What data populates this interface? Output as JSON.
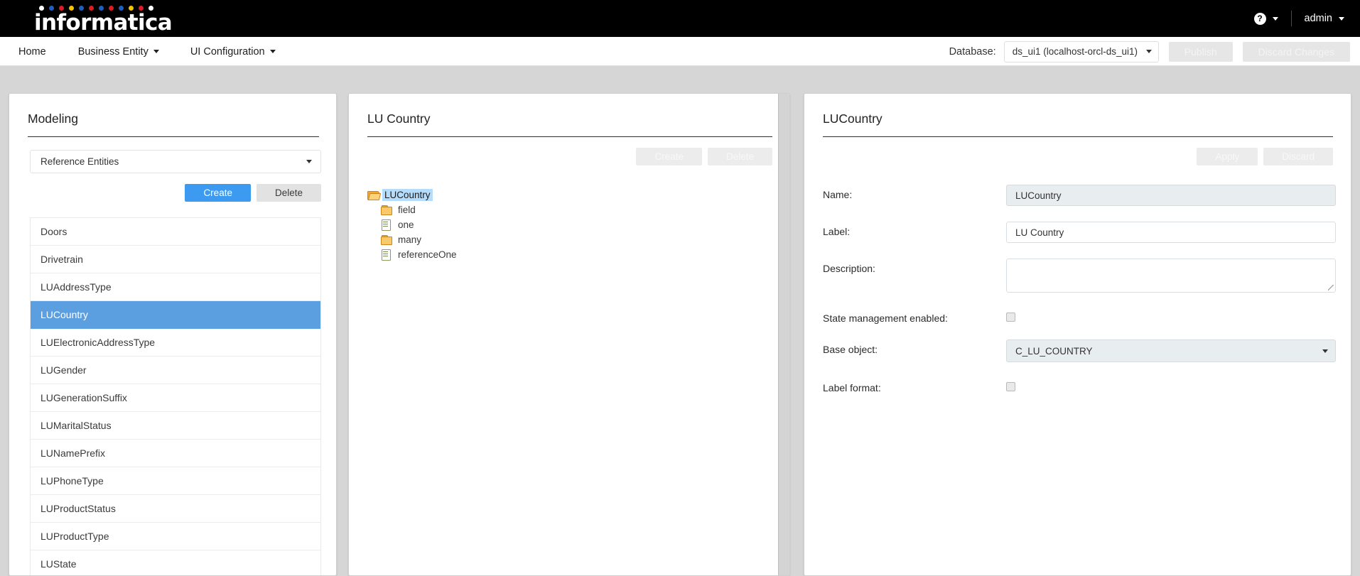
{
  "topbar": {
    "logo_text": "informatica",
    "logo_dot_colors": [
      "#ffffff",
      "#1f5fc4",
      "#e01b24",
      "#f5c400",
      "#1f5fc4",
      "#e01b24",
      "#1f5fc4",
      "#e01b24",
      "#1f5fc4",
      "#f5c400",
      "#e01b24",
      "#ffffff"
    ],
    "help_icon": "help-circle-icon",
    "help_caret_icon": "chevron-down-icon",
    "user_label": "admin",
    "user_caret_icon": "chevron-down-icon"
  },
  "nav": {
    "items": [
      {
        "label": "Home",
        "has_caret": false
      },
      {
        "label": "Business Entity",
        "has_caret": true
      },
      {
        "label": "UI Configuration",
        "has_caret": true
      }
    ],
    "database_label": "Database:",
    "database_value": "ds_ui1 (localhost-orcl-ds_ui1)",
    "database_caret_icon": "chevron-down-icon",
    "publish_label": "Publish",
    "discard_changes_label": "Discard Changes"
  },
  "modeling": {
    "title": "Modeling",
    "type_select_value": "Reference Entities",
    "type_select_caret_icon": "chevron-down-icon",
    "create_label": "Create",
    "delete_label": "Delete",
    "entities": [
      "Doors",
      "Drivetrain",
      "LUAddressType",
      "LUCountry",
      "LUElectronicAddressType",
      "LUGender",
      "LUGenerationSuffix",
      "LUMaritalStatus",
      "LUNamePrefix",
      "LUPhoneType",
      "LUProductStatus",
      "LUProductType",
      "LUState"
    ],
    "selected_entity": "LUCountry",
    "selection_color": "#5c9fe0",
    "primary_color": "#3c9bf0"
  },
  "tree_panel": {
    "title": "LU Country",
    "create_label": "Create",
    "delete_label": "Delete",
    "nodes": [
      {
        "label": "LUCountry",
        "icon": "folder-open-icon",
        "depth": 0,
        "selected": true
      },
      {
        "label": "field",
        "icon": "folder-icon",
        "depth": 1,
        "selected": false
      },
      {
        "label": "one",
        "icon": "document-icon",
        "depth": 1,
        "selected": false
      },
      {
        "label": "many",
        "icon": "folder-icon",
        "depth": 1,
        "selected": false
      },
      {
        "label": "referenceOne",
        "icon": "document-icon",
        "depth": 1,
        "selected": false
      }
    ],
    "node_highlight_color": "#b5dcfb"
  },
  "detail": {
    "title": "LUCountry",
    "apply_label": "Apply",
    "discard_label": "Discard",
    "fields": {
      "name_label": "Name:",
      "name_value": "LUCountry",
      "label_label": "Label:",
      "label_value": "LU Country",
      "description_label": "Description:",
      "description_value": "",
      "state_management_label": "State management enabled:",
      "state_management_checked": false,
      "base_object_label": "Base object:",
      "base_object_value": "C_LU_COUNTRY",
      "base_object_caret_icon": "chevron-down-icon",
      "label_format_label": "Label format:",
      "label_format_checked": false
    }
  }
}
